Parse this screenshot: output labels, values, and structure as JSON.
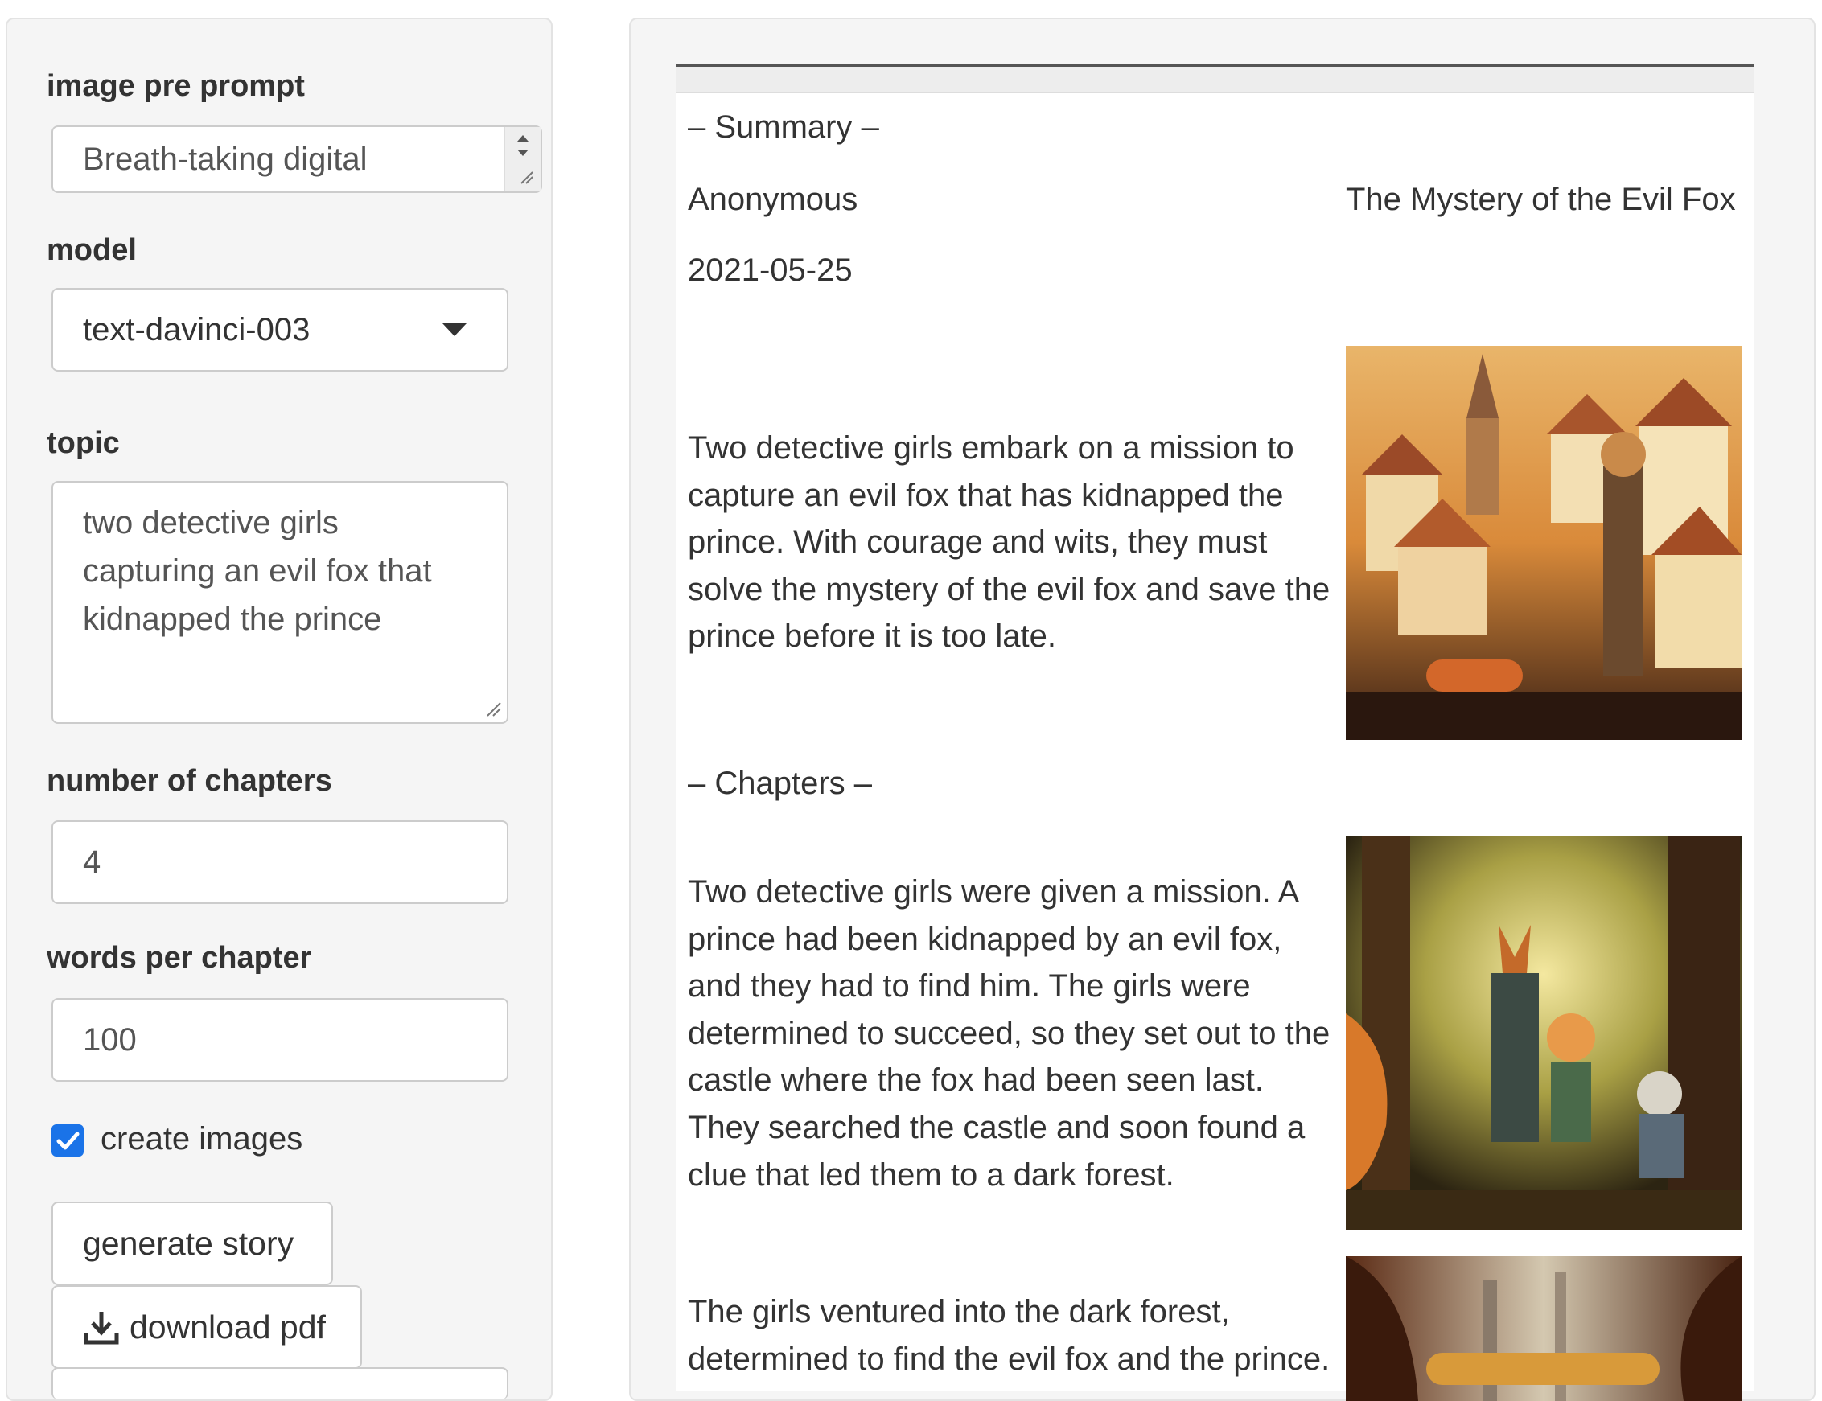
{
  "sidebar": {
    "image_pre_prompt": {
      "label": "image pre prompt",
      "value": "Breath-taking digital"
    },
    "model": {
      "label": "model",
      "value": "text-davinci-003"
    },
    "topic": {
      "label": "topic",
      "value": "two detective girls capturing an evil fox that kidnapped the prince"
    },
    "chapters": {
      "label": "number of chapters",
      "value": "4"
    },
    "words": {
      "label": "words per chapter",
      "value": "100"
    },
    "create_images": {
      "label": "create images",
      "checked": true
    },
    "generate_button": "generate story",
    "download_button": "download pdf"
  },
  "story": {
    "summary_heading": "– Summary –",
    "author": "Anonymous",
    "title": "The Mystery of the Evil Fox",
    "date": "2021-05-25",
    "summary": "Two detective girls embark on a mission to capture an evil fox that has kidnapped the prince. With courage and wits, they must solve the mystery of the evil fox and save the prince before it is too late.",
    "chapters_heading": "– Chapters –",
    "chapters": [
      {
        "text": "Two detective girls were given a mission. A prince had been kidnapped by an evil fox, and they had to find him. The girls were determined to succeed, so they set out to the castle where the fox had been seen last. They searched the castle and soon found a clue that led them to a dark forest."
      },
      {
        "text": "The girls ventured into the dark forest, determined to find the evil fox and the prince."
      }
    ],
    "images": [
      {
        "name": "village-illustration"
      },
      {
        "name": "forest-fox-illustration"
      },
      {
        "name": "dark-forest-illustration"
      }
    ]
  },
  "colors": {
    "panel_bg": "#f5f5f5",
    "checkbox_accent": "#1a73e8"
  }
}
